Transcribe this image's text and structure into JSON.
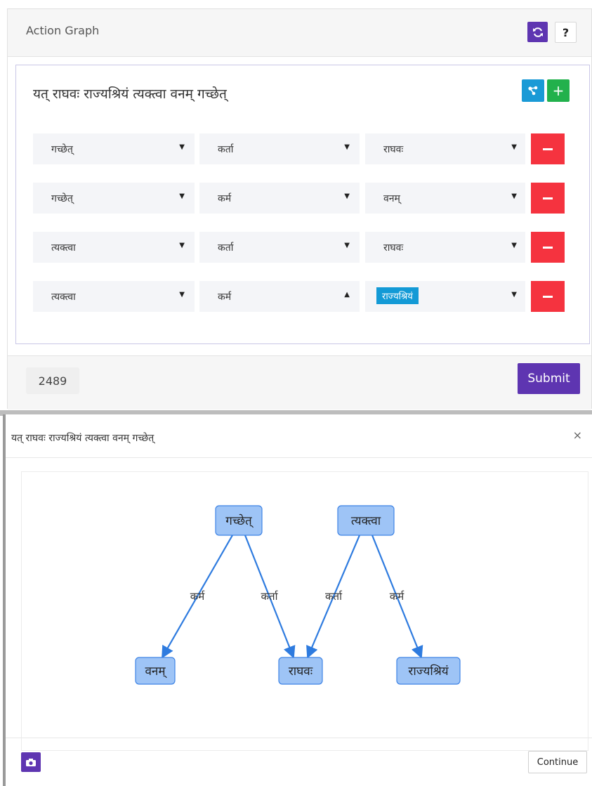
{
  "header": {
    "title": "Action Graph",
    "help_label": "?",
    "refresh_icon": "refresh-icon"
  },
  "sentence": "यत् राघवः राज्यश्रियं त्यक्त्वा वनम् गच्छेत्",
  "toolbar": {
    "graph_icon": "share-graph-icon",
    "add_label": "+"
  },
  "rows": [
    {
      "source": "गच्छेत्",
      "relation": "कर्ता",
      "target": "राघवः",
      "relation_open": false,
      "target_highlight": false
    },
    {
      "source": "गच्छेत्",
      "relation": "कर्म",
      "target": "वनम्",
      "relation_open": false,
      "target_highlight": false
    },
    {
      "source": "त्यक्त्वा",
      "relation": "कर्ता",
      "target": "राघवः",
      "relation_open": false,
      "target_highlight": false
    },
    {
      "source": "त्यक्त्वा",
      "relation": "कर्म",
      "target": "राज्यश्रियं",
      "relation_open": true,
      "target_highlight": true
    }
  ],
  "footer": {
    "counter": "2489",
    "submit_label": "Submit"
  },
  "modal": {
    "title": "यत् राघवः राज्यश्रियं त्यक्त्वा वनम् गच्छेत्",
    "close_label": "×",
    "continue_label": "Continue",
    "camera_icon": "camera-icon"
  },
  "graph": {
    "nodes": [
      {
        "id": "gacchet",
        "label": "गच्छेत्"
      },
      {
        "id": "tyaktva",
        "label": "त्यक्त्वा"
      },
      {
        "id": "vanam",
        "label": "वनम्"
      },
      {
        "id": "raghava",
        "label": "राघवः"
      },
      {
        "id": "rajyashriyam",
        "label": "राज्यश्रियं"
      }
    ],
    "edges": [
      {
        "from": "gacchet",
        "to": "vanam",
        "label": "कर्म"
      },
      {
        "from": "gacchet",
        "to": "raghava",
        "label": "कर्ता"
      },
      {
        "from": "tyaktva",
        "to": "raghava",
        "label": "कर्ता"
      },
      {
        "from": "tyaktva",
        "to": "rajyashriyam",
        "label": "कर्म"
      }
    ]
  },
  "colors": {
    "purple": "#5e35b1",
    "blue": "#1a9ad6",
    "green": "#22b14c",
    "red": "#f5333f",
    "node_fill": "#9ec4f6",
    "node_stroke": "#3f84e5",
    "edge": "#2e7bdf"
  }
}
